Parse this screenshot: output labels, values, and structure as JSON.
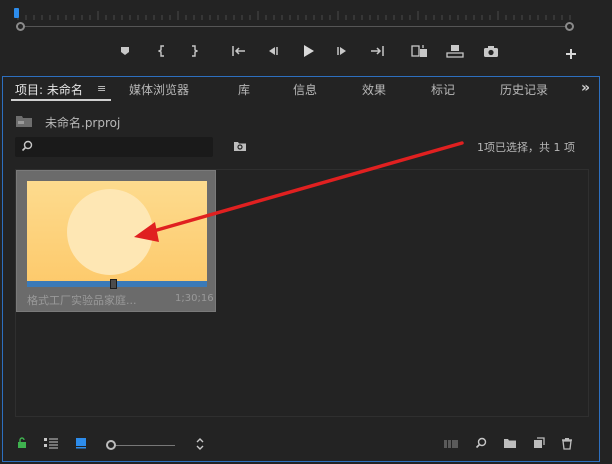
{
  "tabs": [
    {
      "label": "项目: 未命名"
    },
    {
      "label": "媒体浏览器"
    },
    {
      "label": "库"
    },
    {
      "label": "信息"
    },
    {
      "label": "效果"
    },
    {
      "label": "标记"
    },
    {
      "label": "历史记录"
    }
  ],
  "tab_menu": "≡",
  "overflow": "»",
  "project": {
    "file_name": "未命名.prproj"
  },
  "search": {
    "placeholder": "",
    "value": ""
  },
  "selection_info": "1项已选择，共 1 项",
  "clip": {
    "name": "格式工厂实验品家庭...",
    "duration": "1;30;16",
    "progress": 0.48
  },
  "colors": {
    "accent": "#2d6fbf",
    "arrow": "#e02020",
    "thumb_bg": "#fdd27a"
  },
  "icons": {
    "transport": [
      "marker-icon",
      "mark-in-icon",
      "mark-out-icon",
      "go-to-in-icon",
      "step-back-icon",
      "play-icon",
      "step-forward-icon",
      "go-to-out-icon",
      "insert-icon",
      "overwrite-icon",
      "export-frame-icon",
      "add-button-icon"
    ],
    "footer": [
      "lock-icon",
      "list-view-icon",
      "icon-view-icon",
      "zoom-slider-icon",
      "sort-icon",
      "automate-sequence-icon",
      "find-icon",
      "new-bin-icon",
      "new-item-icon",
      "clear-icon"
    ]
  }
}
